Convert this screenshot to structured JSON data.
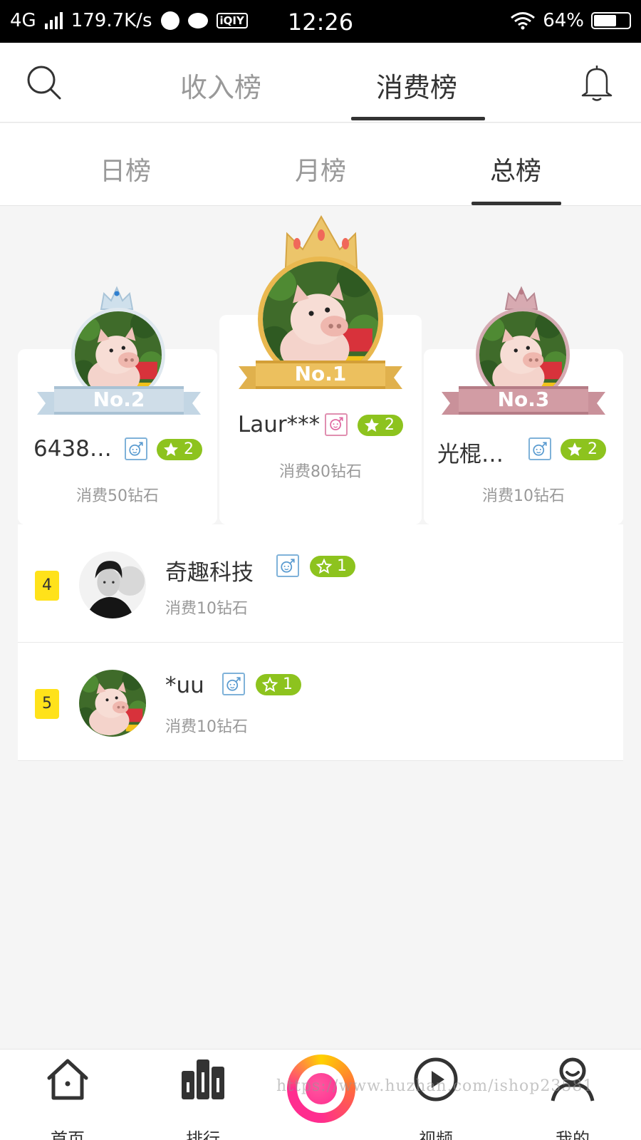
{
  "status_bar": {
    "network": "4G",
    "speed": "179.7K/s",
    "iqiyi": "iQIY",
    "time": "12:26",
    "battery": "64%",
    "battery_level": 0.64
  },
  "header": {
    "tabs": [
      "收入榜",
      "消费榜"
    ],
    "active_tab": "消费榜"
  },
  "sub_tabs": {
    "items": [
      "日榜",
      "月榜",
      "总榜"
    ],
    "active": "总榜"
  },
  "podium": {
    "first": {
      "rank_label": "No.1",
      "name": "Laur***",
      "gender": "female",
      "level": "2",
      "consumption": "消费80钻石"
    },
    "second": {
      "rank_label": "No.2",
      "name": "6438…",
      "gender": "male",
      "level": "2",
      "consumption": "消费50钻石"
    },
    "third": {
      "rank_label": "No.3",
      "name": "光棍…",
      "gender": "male",
      "level": "2",
      "consumption": "消费10钻石"
    }
  },
  "list": [
    {
      "rank": "4",
      "name": "奇趣科技",
      "gender": "male",
      "level": "1",
      "consumption": "消费10钻石"
    },
    {
      "rank": "5",
      "name": "*uu",
      "gender": "male",
      "level": "1",
      "consumption": "消费10钻石"
    }
  ],
  "bottom_nav": {
    "home": "首页",
    "rank": "排行",
    "video": "视频",
    "mine": "我的"
  },
  "watermark": "https://www.huzhan.com/ishop23581",
  "colors": {
    "gold": "#e9b84f",
    "silver": "#b9cfe0",
    "bronze": "#c48b95",
    "level_badge": "#8dc31e",
    "rank_badge": "#ffe21a"
  }
}
